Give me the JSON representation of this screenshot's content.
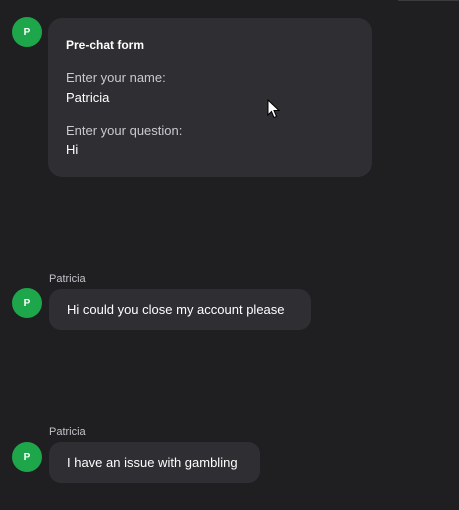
{
  "form_message": {
    "avatar_initial": "P",
    "title": "Pre-chat form",
    "fields": [
      {
        "label": "Enter your name:",
        "value": "Patricia"
      },
      {
        "label": "Enter your question:",
        "value": "Hi"
      }
    ]
  },
  "messages": [
    {
      "sender": "Patricia",
      "avatar_initial": "P",
      "text": "Hi could you close my account please"
    },
    {
      "sender": "Patricia",
      "avatar_initial": "P",
      "text": "I have an issue with gambling"
    }
  ],
  "colors": {
    "background": "#1f1f22",
    "bubble": "#2e2e33",
    "avatar": "#1ea64a"
  },
  "icons": [
    "mouse-pointer-icon"
  ]
}
